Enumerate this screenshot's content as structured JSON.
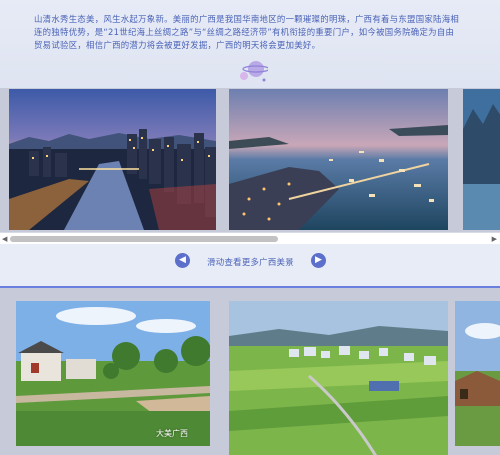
{
  "intro": {
    "text": "山清水秀生态美，风生水起万象新。美丽的广西是我国华南地区的一颗璀璨的明珠，广西有着与东盟国家陆海相连的独特优势，是“21世纪海上丝绸之路”与“丝绸之路经济带”有机衔接的重要门户，如今被国务院确定为自由贸易试验区，相信广西的潜力将会被更好发掘，广西的明天将会更加美好。"
  },
  "gallery_top": {
    "photos": [
      {
        "name": "city-river-night-photo",
        "scene": "city-river-night"
      },
      {
        "name": "harbor-bay-photo",
        "scene": "harbor-bay"
      },
      {
        "name": "karst-mountain-photo",
        "scene": "karst-mountain"
      }
    ]
  },
  "caption": {
    "label": "滑动查看更多广西美景",
    "prev_icon": "chevron-left-icon",
    "next_icon": "chevron-right-icon"
  },
  "gallery_bottom": {
    "photos": [
      {
        "name": "village-garden-photo",
        "scene": "village-garden"
      },
      {
        "name": "rice-field-village-photo",
        "scene": "rice-field-village"
      },
      {
        "name": "rural-house-photo",
        "scene": "rural-house"
      }
    ],
    "watermark": "大美广西"
  },
  "colors": {
    "accent": "#5c6fcb",
    "text": "#4a63b8",
    "divider": "#6a7fe0"
  }
}
